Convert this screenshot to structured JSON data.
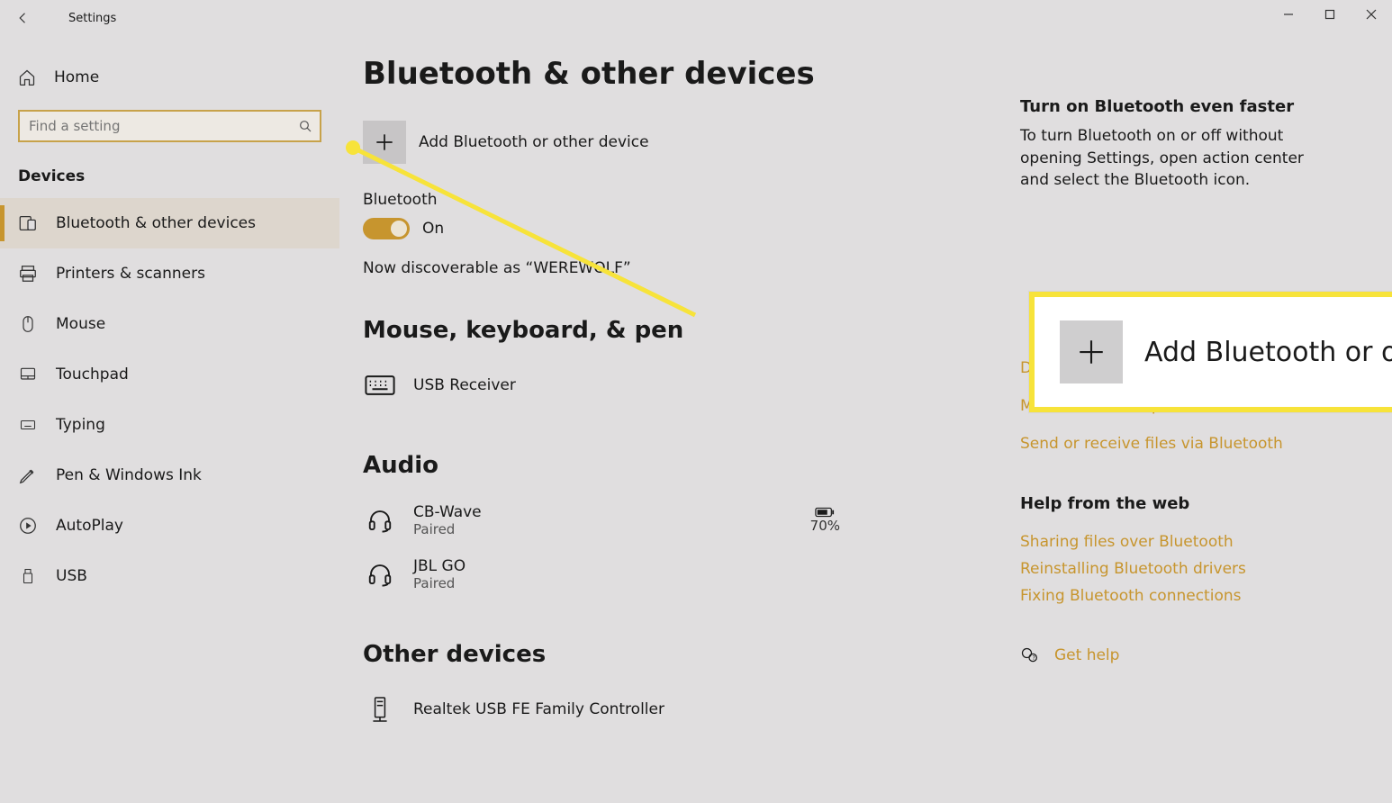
{
  "window": {
    "title": "Settings"
  },
  "sidebar": {
    "home": "Home",
    "search_placeholder": "Find a setting",
    "section": "Devices",
    "items": [
      {
        "label": "Bluetooth & other devices",
        "active": true
      },
      {
        "label": "Printers & scanners"
      },
      {
        "label": "Mouse"
      },
      {
        "label": "Touchpad"
      },
      {
        "label": "Typing"
      },
      {
        "label": "Pen & Windows Ink"
      },
      {
        "label": "AutoPlay"
      },
      {
        "label": "USB"
      }
    ]
  },
  "page": {
    "title": "Bluetooth & other devices",
    "add_label": "Add Bluetooth or other device",
    "bluetooth_label": "Bluetooth",
    "bluetooth_state": "On",
    "discoverable": "Now discoverable as “WEREWOLF”",
    "groups": {
      "mouse": {
        "title": "Mouse, keyboard, & pen",
        "items": [
          {
            "name": "USB Receiver"
          }
        ]
      },
      "audio": {
        "title": "Audio",
        "items": [
          {
            "name": "CB-Wave",
            "status": "Paired",
            "battery": "70%"
          },
          {
            "name": "JBL GO",
            "status": "Paired"
          }
        ]
      },
      "other": {
        "title": "Other devices",
        "items": [
          {
            "name": "Realtek USB FE Family Controller"
          }
        ]
      }
    }
  },
  "tip": {
    "title": "Turn on Bluetooth even faster",
    "body": "To turn Bluetooth on or off without opening Settings, open action center and select the Bluetooth icon."
  },
  "related_links": [
    "Display settings",
    "More Bluetooth options",
    "Send or receive files via Bluetooth"
  ],
  "help": {
    "title": "Help from the web",
    "links": [
      "Sharing files over Bluetooth",
      "Reinstalling Bluetooth drivers",
      "Fixing Bluetooth connections"
    ],
    "get_help": "Get help"
  },
  "callout": {
    "text": "Add Bluetooth or other device"
  }
}
